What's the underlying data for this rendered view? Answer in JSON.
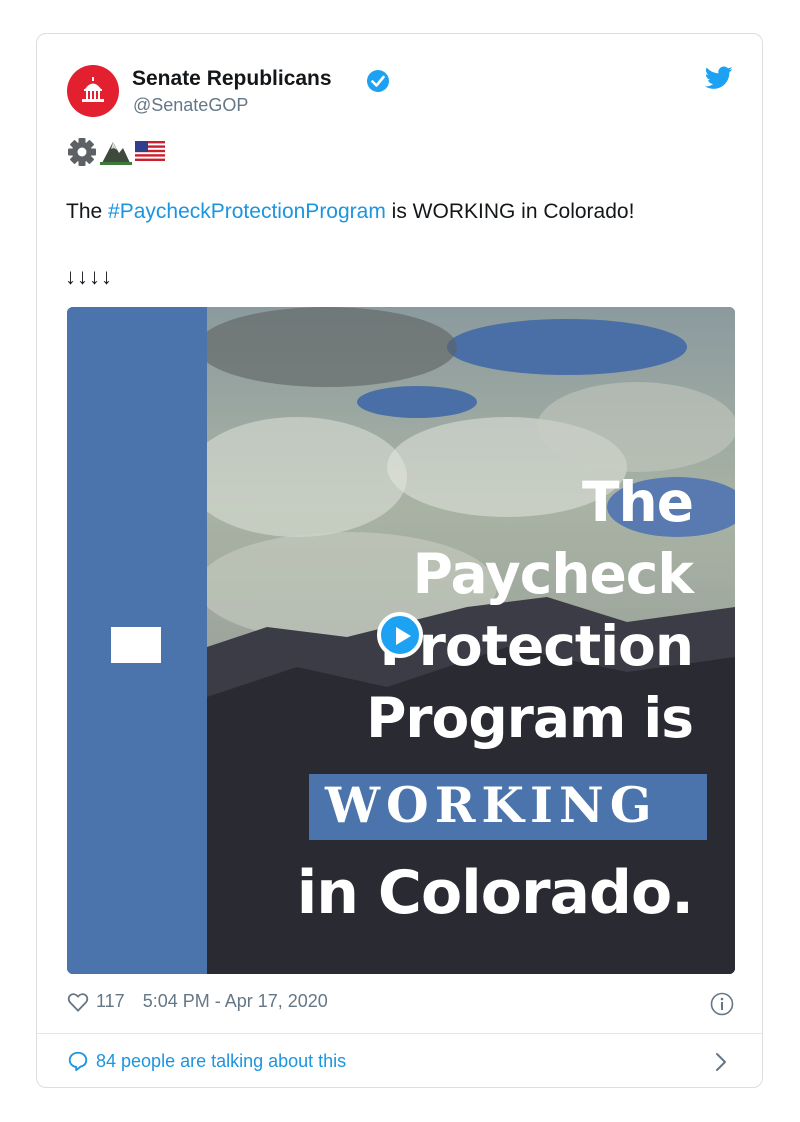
{
  "account": {
    "name": "Senate Republicans",
    "handle": "@SenateGOP"
  },
  "tweet": {
    "text_before": "The ",
    "hashtag": "#PaycheckProtectionProgram",
    "text_after": " is WORKING in Colorado!",
    "arrows": "↓↓↓↓",
    "emoji_icons": [
      "gear-icon",
      "mountain-icon",
      "us-flag-icon"
    ]
  },
  "media": {
    "line1": "The",
    "line2": "Paycheck",
    "line3": "Protection",
    "line4": "Program is",
    "line5": "WORKING",
    "line6": "in Colorado.",
    "stripe_color": "#4a74ab"
  },
  "meta": {
    "likes": "117",
    "timestamp": "5:04 PM - Apr 17, 2020"
  },
  "footer": {
    "talking": "84 people are talking about this"
  },
  "colors": {
    "accent": "#1da1f2",
    "brand_red": "#e2202f",
    "link": "#1b95e0"
  }
}
